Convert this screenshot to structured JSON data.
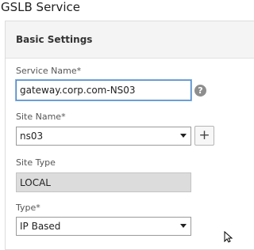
{
  "page": {
    "title": "GSLB Service"
  },
  "panel": {
    "title": "Basic Settings"
  },
  "service_name": {
    "label": "Service Name*",
    "value": "gateway.corp.com-NS03",
    "help_icon": "question-circle-icon"
  },
  "site_name": {
    "label": "Site Name*",
    "value": "ns03",
    "add_label": "+",
    "add_icon": "plus-icon"
  },
  "site_type": {
    "label": "Site Type",
    "value": "LOCAL"
  },
  "type": {
    "label": "Type*",
    "value": "IP Based"
  },
  "colors": {
    "focus_border": "#4a86c5",
    "readonly_bg": "#dcdcdc",
    "header_bg": "#f4f4f4"
  }
}
